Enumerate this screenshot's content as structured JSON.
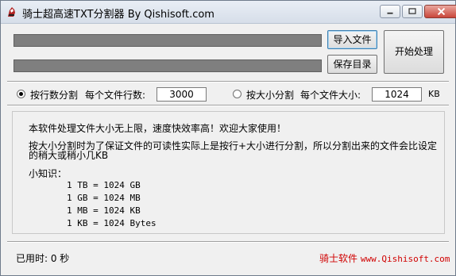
{
  "window": {
    "title": "骑士超高速TXT分割器  By Qishisoft.com"
  },
  "buttons": {
    "import_file": "导入文件",
    "save_dir": "保存目录",
    "start": "开始处理"
  },
  "options": {
    "by_lines_label": "按行数分割",
    "lines_per_file_label": "每个文件行数:",
    "lines_per_file_value": "3000",
    "by_size_label": "按大小分割",
    "size_per_file_label": "每个文件大小:",
    "size_per_file_value": "1024",
    "size_unit": "KB",
    "selected": "by_lines"
  },
  "info": {
    "line1": "本软件处理文件大小无上限，速度快效率高！欢迎大家使用！",
    "line2": "按大小分割时为了保证文件的可读性实际上是按行+大小进行分割，所以分割出来的文件会比设定",
    "line3": "的稍大或稍小几KB",
    "tips_title": "小知识：",
    "conversions": [
      "1 TB = 1024 GB",
      "1 GB = 1024 MB",
      "1 MB = 1024 KB",
      "1 KB = 1024 Bytes"
    ]
  },
  "status": {
    "elapsed": "已用时: 0 秒",
    "brand": "骑士软件",
    "site": "www.Qishisoft.com"
  }
}
